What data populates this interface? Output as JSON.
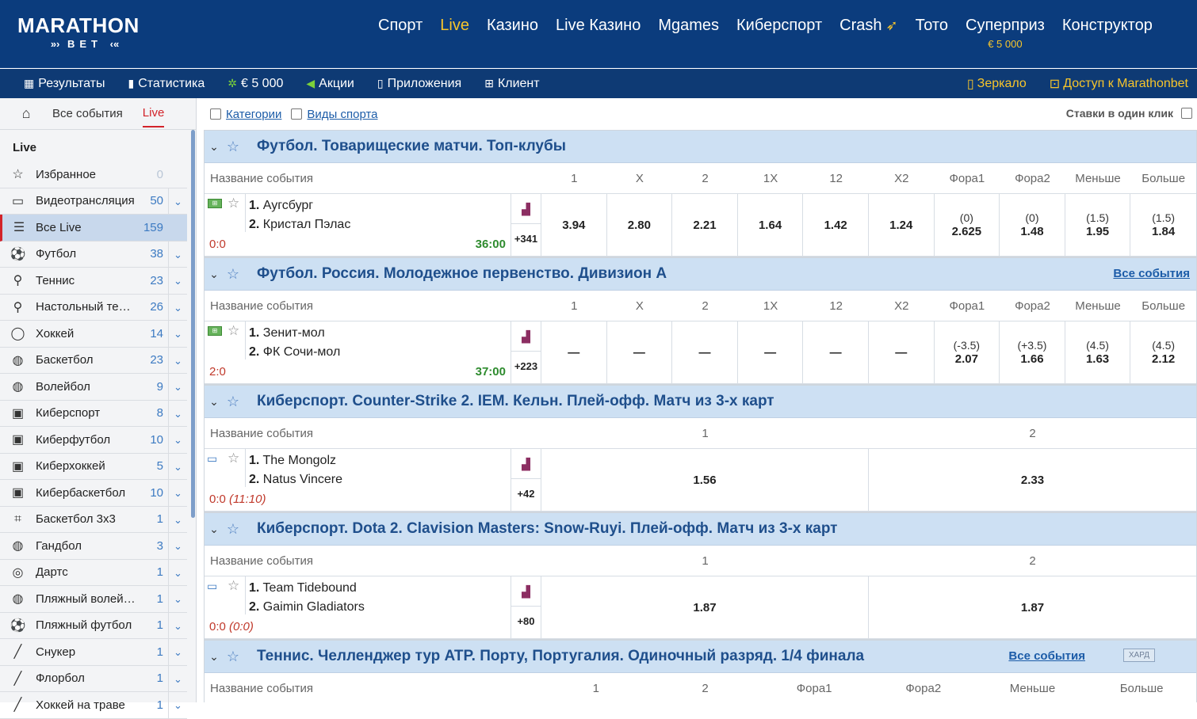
{
  "topbar": {
    "logo_main": "MARATHON",
    "logo_sub": "BET",
    "nav": [
      {
        "label": "Спорт",
        "active": false
      },
      {
        "label": "Live",
        "active": true
      },
      {
        "label": "Казино",
        "active": false
      },
      {
        "label": "Live Казино",
        "active": false
      },
      {
        "label": "Mgames",
        "active": false
      },
      {
        "label": "Киберспорт",
        "active": false
      },
      {
        "label": "Crash",
        "active": false
      },
      {
        "label": "Тото",
        "active": false
      },
      {
        "label": "Суперприз",
        "active": false,
        "sub": "€ 5 000"
      },
      {
        "label": "Конструктор",
        "active": false
      }
    ]
  },
  "subbar": {
    "results": "Результаты",
    "stats": "Статистика",
    "prize": "€ 5 000",
    "promos": "Акции",
    "apps": "Приложения",
    "client": "Клиент",
    "mirror": "Зеркало",
    "access": "Доступ к Marathonbet"
  },
  "sidebar": {
    "tab_all": "Все события",
    "tab_live": "Live",
    "heading": "Live",
    "items": [
      {
        "label": "Избранное",
        "count": "0",
        "icon": "☆",
        "chev": false
      },
      {
        "label": "Видеотрансляция",
        "count": "50",
        "icon": "▭",
        "chev": true
      },
      {
        "label": "Все Live",
        "count": "159",
        "icon": "☰",
        "chev": false,
        "selected": true
      },
      {
        "label": "Футбол",
        "count": "38",
        "icon": "⚽",
        "chev": true
      },
      {
        "label": "Теннис",
        "count": "23",
        "icon": "⚲",
        "chev": true
      },
      {
        "label": "Настольный те…",
        "count": "26",
        "icon": "⚲",
        "chev": true
      },
      {
        "label": "Хоккей",
        "count": "14",
        "icon": "◯",
        "chev": true
      },
      {
        "label": "Баскетбол",
        "count": "23",
        "icon": "◍",
        "chev": true
      },
      {
        "label": "Волейбол",
        "count": "9",
        "icon": "◍",
        "chev": true
      },
      {
        "label": "Киберспорт",
        "count": "8",
        "icon": "▣",
        "chev": true
      },
      {
        "label": "Киберфутбол",
        "count": "10",
        "icon": "▣",
        "chev": true
      },
      {
        "label": "Киберхоккей",
        "count": "5",
        "icon": "▣",
        "chev": true
      },
      {
        "label": "Кибербаскетбол",
        "count": "10",
        "icon": "▣",
        "chev": true
      },
      {
        "label": "Баскетбол 3x3",
        "count": "1",
        "icon": "⌗",
        "chev": true
      },
      {
        "label": "Гандбол",
        "count": "3",
        "icon": "◍",
        "chev": true
      },
      {
        "label": "Дартс",
        "count": "1",
        "icon": "◎",
        "chev": true
      },
      {
        "label": "Пляжный волейб…",
        "count": "1",
        "icon": "◍",
        "chev": true
      },
      {
        "label": "Пляжный футбол",
        "count": "1",
        "icon": "⚽",
        "chev": true
      },
      {
        "label": "Снукер",
        "count": "1",
        "icon": "╱",
        "chev": true
      },
      {
        "label": "Флорбол",
        "count": "1",
        "icon": "╱",
        "chev": true
      },
      {
        "label": "Хоккей на траве",
        "count": "1",
        "icon": "╱",
        "chev": true
      }
    ]
  },
  "filters": {
    "categories": "Категории",
    "sports": "Виды спорта",
    "one_click": "Ставки в один клик"
  },
  "leagues": [
    {
      "title": "Футбол. Товарищеские матчи. Топ-клубы",
      "all_events": "",
      "icon": "field",
      "columns": [
        "1",
        "X",
        "2",
        "1X",
        "12",
        "X2",
        "Фора1",
        "Фора2",
        "Меньше",
        "Больше"
      ],
      "event": {
        "team1": "Аугсбург",
        "team2": "Кристал Пэлас",
        "score": "0:0",
        "score_extra": "",
        "time": "36:00",
        "more": "+341",
        "odds": [
          {
            "h": "",
            "v": "3.94"
          },
          {
            "h": "",
            "v": "2.80"
          },
          {
            "h": "",
            "v": "2.21"
          },
          {
            "h": "",
            "v": "1.64"
          },
          {
            "h": "",
            "v": "1.42"
          },
          {
            "h": "",
            "v": "1.24"
          },
          {
            "h": "(0)",
            "v": "2.625"
          },
          {
            "h": "(0)",
            "v": "1.48"
          },
          {
            "h": "(1.5)",
            "v": "1.95"
          },
          {
            "h": "(1.5)",
            "v": "1.84"
          }
        ]
      }
    },
    {
      "title": "Футбол. Россия. Молодежное первенство. Дивизион А",
      "all_events": "Все события",
      "icon": "field",
      "columns": [
        "1",
        "X",
        "2",
        "1X",
        "12",
        "X2",
        "Фора1",
        "Фора2",
        "Меньше",
        "Больше"
      ],
      "event": {
        "team1": "Зенит-мол",
        "team2": "ФК Сочи-мол",
        "score": "2:0",
        "score_extra": "",
        "time": "37:00",
        "more": "+223",
        "odds": [
          {
            "h": "",
            "v": "—"
          },
          {
            "h": "",
            "v": "—"
          },
          {
            "h": "",
            "v": "—"
          },
          {
            "h": "",
            "v": "—"
          },
          {
            "h": "",
            "v": "—"
          },
          {
            "h": "",
            "v": "—"
          },
          {
            "h": "(-3.5)",
            "v": "2.07"
          },
          {
            "h": "(+3.5)",
            "v": "1.66"
          },
          {
            "h": "(4.5)",
            "v": "1.63"
          },
          {
            "h": "(4.5)",
            "v": "2.12"
          }
        ]
      }
    },
    {
      "title": "Киберспорт. Counter-Strike 2. IEM. Кельн. Плей-офф. Матч из 3-х карт",
      "all_events": "",
      "icon": "tv",
      "columns": [
        "1",
        "2"
      ],
      "event": {
        "team1": "The Mongolz",
        "team2": "Natus Vincere",
        "score": "0:0",
        "score_extra": "(11:10)",
        "time": "",
        "more": "+42",
        "odds": [
          {
            "h": "",
            "v": "1.56"
          },
          {
            "h": "",
            "v": "2.33"
          }
        ]
      }
    },
    {
      "title": "Киберспорт. Dota 2. Clavision Masters: Snow-Ruyi. Плей-офф. Матч из 3-х карт",
      "all_events": "",
      "icon": "tv",
      "columns": [
        "1",
        "2"
      ],
      "event": {
        "team1": "Team Tidebound",
        "team2": "Gaimin Gladiators",
        "score": "0:0",
        "score_extra": "(0:0)",
        "time": "",
        "more": "+80",
        "odds": [
          {
            "h": "",
            "v": "1.87"
          },
          {
            "h": "",
            "v": "1.87"
          }
        ]
      }
    },
    {
      "title": "Теннис. Челленджер тур ATP. Порту, Португалия. Одиночный разряд. 1/4 финала",
      "all_events": "Все события",
      "surface": "ХАРД",
      "columns": [
        "1",
        "2",
        "Фора1",
        "Фора2",
        "Меньше",
        "Больше"
      ]
    }
  ],
  "colors": {
    "brand": "#0b3c7d",
    "accent": "#f7c52b",
    "league_bg": "#cde0f3",
    "live_red": "#d2232a"
  }
}
